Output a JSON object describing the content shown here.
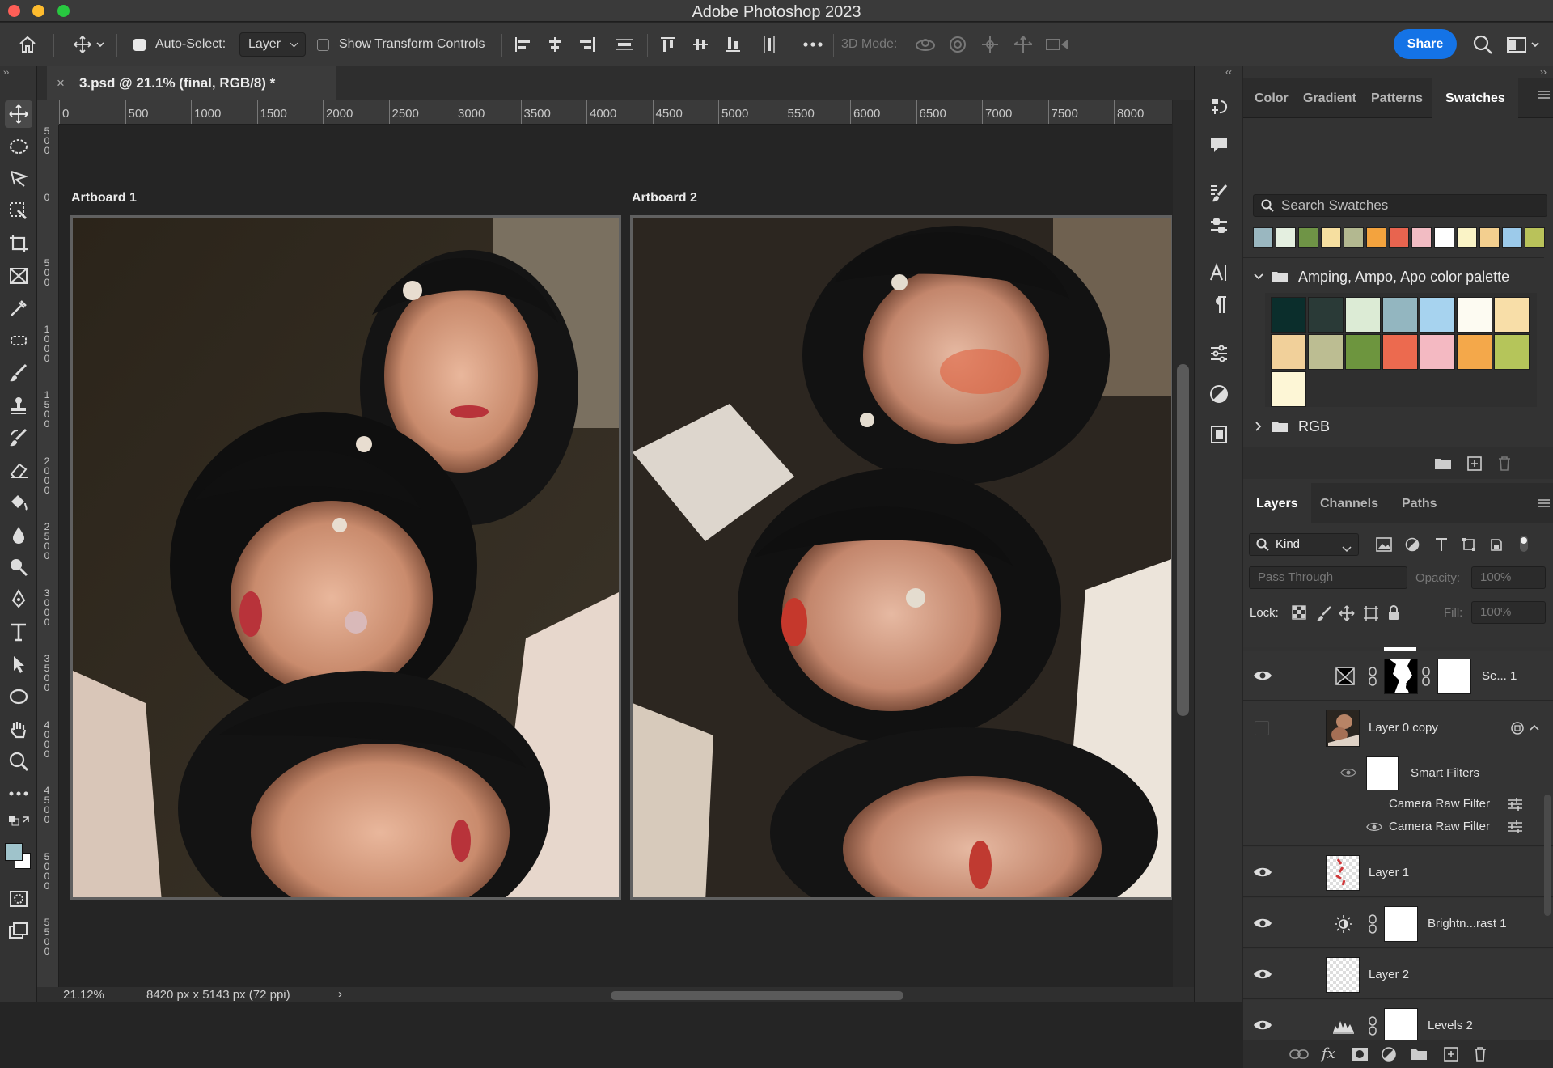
{
  "app": {
    "title": "Adobe Photoshop 2023"
  },
  "options_bar": {
    "auto_select_label": "Auto-Select:",
    "auto_select_value": "Layer",
    "show_transform_label": "Show Transform Controls",
    "three_d_mode_label": "3D Mode:",
    "share_label": "Share"
  },
  "document": {
    "tab_title": "3.psd @ 21.1% (final, RGB/8) *",
    "close_glyph": "×",
    "artboards": [
      "Artboard 1",
      "Artboard 2"
    ],
    "ruler_h": [
      "0",
      "500",
      "1000",
      "1500",
      "2000",
      "2500",
      "3000",
      "3500",
      "4000",
      "4500",
      "5000",
      "5500",
      "6000",
      "6500",
      "7000",
      "7500",
      "8000"
    ],
    "ruler_v": [
      "500",
      "0",
      "500",
      "1000",
      "1500",
      "2000",
      "2500",
      "3000",
      "3500",
      "4000",
      "4500",
      "5000",
      "5500"
    ]
  },
  "status": {
    "zoom": "21.12%",
    "dimensions": "8420 px x 5143 px (72 ppi)",
    "arrow": "›"
  },
  "swatches_panel": {
    "tabs": [
      "Color",
      "Gradient",
      "Patterns",
      "Swatches"
    ],
    "active_tab": "Swatches",
    "search_placeholder": "Search Swatches",
    "recent_colors": [
      "#9ab7c0",
      "#e4efe0",
      "#6f9446",
      "#f6dfa0",
      "#b3b890",
      "#f3a33e",
      "#e8644f",
      "#f2bcc3",
      "#ffffff",
      "#faf3c6",
      "#f3cf8f",
      "#9ccaea",
      "#b9c25a"
    ],
    "folders": [
      {
        "name": "Amping, Ampo, Apo color palette",
        "expanded": true,
        "colors": [
          "#0b2e2c",
          "#2a3a37",
          "#dcebd5",
          "#93b6c0",
          "#a7d3ef",
          "#fdfbf2",
          "#f8dea8",
          "#f1d09a",
          "#bcbd92",
          "#6d953e",
          "#ec6a4f",
          "#f4b9c2",
          "#f4a84a",
          "#b5c55a",
          "#fdf6d6"
        ]
      },
      {
        "name": "RGB",
        "expanded": false
      }
    ]
  },
  "layers_panel": {
    "tabs": [
      "Layers",
      "Channels",
      "Paths"
    ],
    "active_tab": "Layers",
    "filter_kind": "Kind",
    "blend_mode": "Pass Through",
    "opacity_label": "Opacity:",
    "opacity_value": "100%",
    "lock_label": "Lock:",
    "fill_label": "Fill:",
    "fill_value": "100%",
    "layers": [
      {
        "name": "Se... 1",
        "visible": true
      },
      {
        "name": "Layer 0 copy",
        "visible": false
      },
      {
        "name": "Smart Filters",
        "visible": true
      },
      {
        "name": "Camera Raw Filter",
        "visible": false
      },
      {
        "name": "Camera Raw Filter",
        "visible": true
      },
      {
        "name": "Layer 1",
        "visible": true
      },
      {
        "name": "Brightn...rast 1",
        "visible": true
      },
      {
        "name": "Layer 2",
        "visible": true
      },
      {
        "name": "Levels 2",
        "visible": true
      }
    ],
    "footer_fx": "fx"
  },
  "colors": {
    "accent": "#1473e6",
    "foreground": "#9fc3cb",
    "background": "#ffffff"
  }
}
